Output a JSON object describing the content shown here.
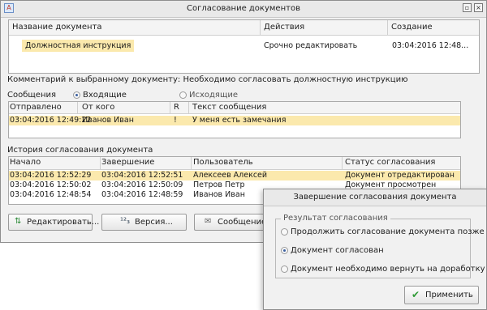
{
  "window": {
    "title": "Согласование документов"
  },
  "documents": {
    "columns": [
      "Название документа",
      "Действия",
      "Создание"
    ],
    "rows": [
      {
        "name": "Должностная инструкция",
        "action": "Срочно редактировать",
        "created": "03:04:2016 12:48..."
      }
    ]
  },
  "comment": "Комментарий к выбранному документу: Необходимо согласовать должностную инструкцию",
  "messages": {
    "label": "Сообщения",
    "incoming_label": "Входящие",
    "outgoing_label": "Исходящие",
    "selected": "incoming",
    "columns": [
      "Отправлено",
      "От кого",
      "R",
      "Текст сообщения"
    ],
    "rows": [
      {
        "sent": "03:04:2016  12:49:22",
        "from": "Иванов Иван",
        "r": "!",
        "text": "У меня есть замечания"
      }
    ]
  },
  "history": {
    "label": "История согласования документа",
    "columns": [
      "Начало",
      "Завершение",
      "Пользователь",
      "Статус согласования"
    ],
    "rows": [
      {
        "start": "03:04:2016  12:52:29",
        "end": "03:04:2016  12:52:51",
        "user": "Алексеев Алексей",
        "status": "Документ отредактирован"
      },
      {
        "start": "03:04:2016  12:50:02",
        "end": "03:04:2016  12:50:09",
        "user": "Петров Петр",
        "status": "Документ просмотрен"
      },
      {
        "start": "03:04:2016  12:48:54",
        "end": "03:04:2016  12:48:59",
        "user": "Иванов Иван",
        "status": ""
      }
    ]
  },
  "buttons": {
    "edit": "Редактировать...",
    "version": "Версия...",
    "message": "Сообщение..."
  },
  "dialog": {
    "title": "Завершение согласования документа",
    "group_title": "Результат согласования",
    "options": [
      "Продолжить согласование документа позже",
      "Документ согласован",
      "Документ необходимо вернуть на доработку"
    ],
    "selected_index": 1,
    "apply": "Применить"
  },
  "colors": {
    "selection": "#fbe9ad",
    "accent": "#3b5fa0"
  }
}
